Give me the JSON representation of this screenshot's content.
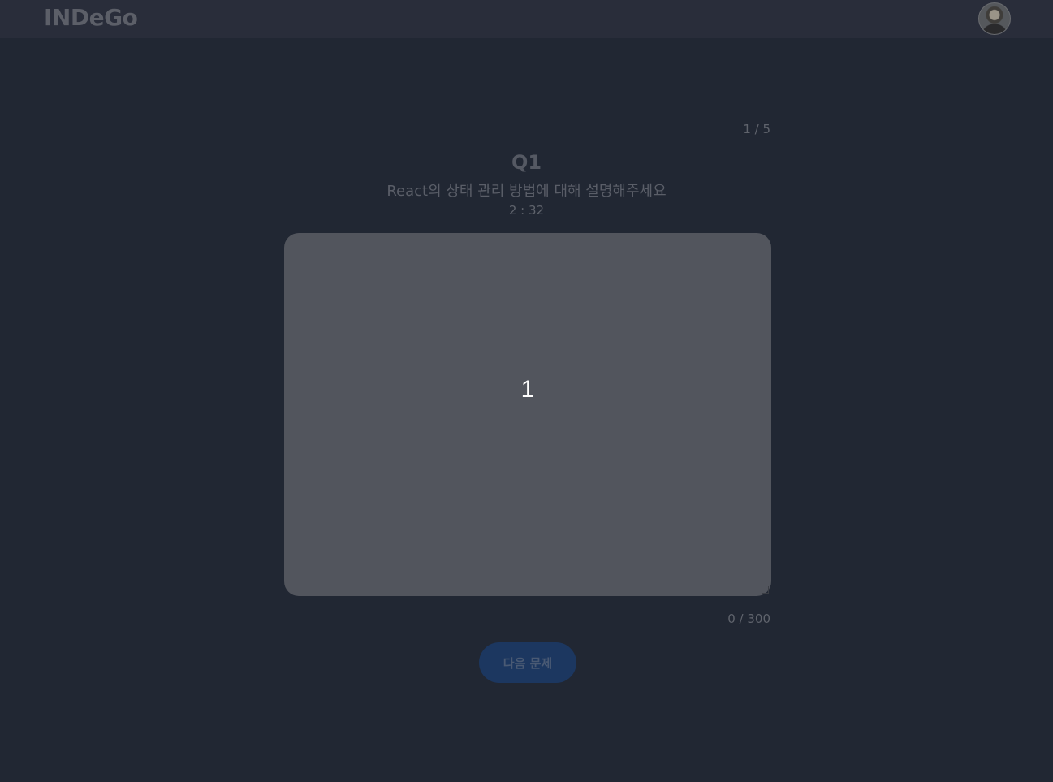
{
  "header": {
    "logo_text": "INDeGo",
    "avatar_alt": "user-avatar"
  },
  "quiz": {
    "progress": "1 / 5",
    "question_number": "Q1",
    "question_text": "React의 상태 관리 방법에 대해 설명해주세요",
    "timer": "2 : 32",
    "countdown_overlay": "1",
    "char_count": "0 / 300",
    "next_button_label": "다음 문제"
  },
  "colors": {
    "background": "#212733",
    "topbar": "#292d3a",
    "answer_box": "#52555d",
    "next_button": "#1c3760"
  }
}
